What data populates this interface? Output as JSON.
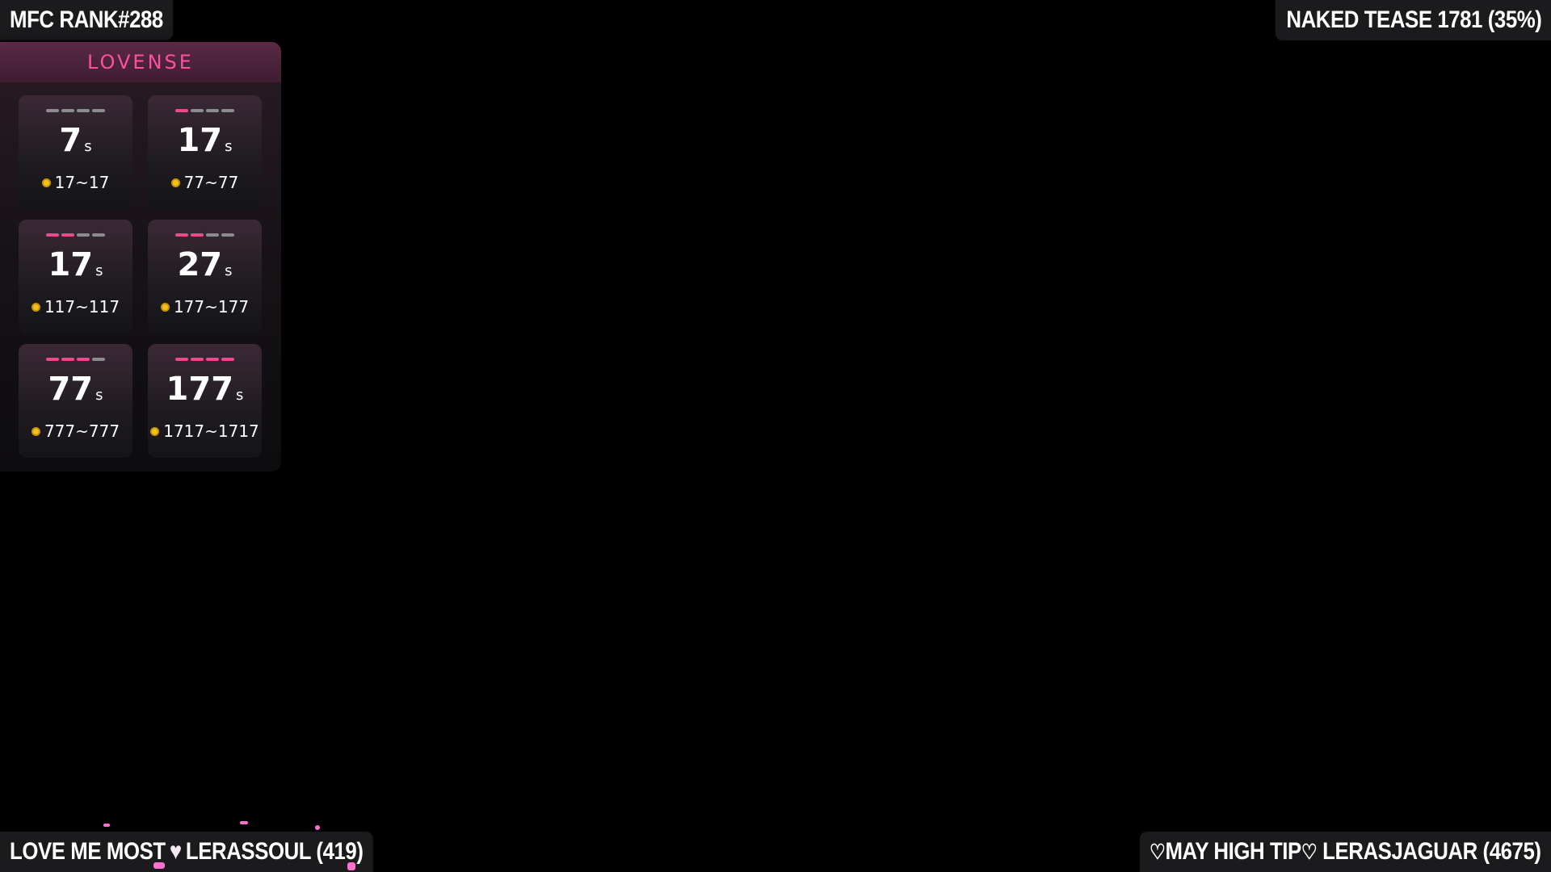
{
  "top_left": {
    "rank_text": "MFC RANK#288"
  },
  "top_right": {
    "goal_text": "NAKED TEASE 1781 (35%)"
  },
  "bottom_left": {
    "label": "LOVE ME MOST",
    "heart_icon": "heart-filled",
    "user": "LERASSOUL (419)"
  },
  "bottom_right": {
    "heart_icon": "heart-outline",
    "label": "MAY HIGH TIP",
    "user": "LERASJAGUAR (4675)"
  },
  "lovense": {
    "brand": "LOVENSE",
    "accent_color": "#f0478f",
    "coin_color": "#f3c21a",
    "unit": "s",
    "levels": [
      {
        "active": 0,
        "duration": "7",
        "range": "17~17"
      },
      {
        "active": 1,
        "duration": "17",
        "range": "77~77"
      },
      {
        "active": 2,
        "duration": "17",
        "range": "117~117"
      },
      {
        "active": 2,
        "duration": "27",
        "range": "177~177"
      },
      {
        "active": 3,
        "duration": "77",
        "range": "777~777"
      },
      {
        "active": 4,
        "duration": "177",
        "range": "1717~1717"
      }
    ]
  }
}
